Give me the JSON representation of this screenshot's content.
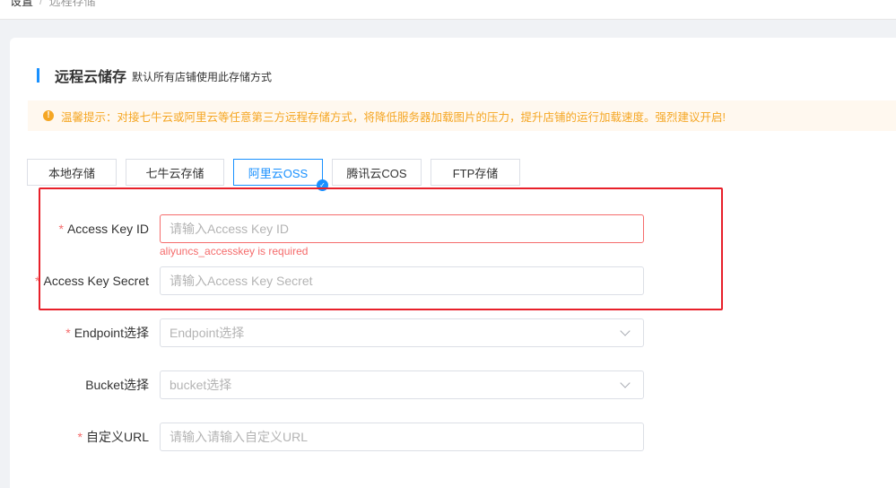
{
  "breadcrumb": {
    "parent": "设置",
    "separator": "/",
    "current": "远程存储"
  },
  "section": {
    "title": "远程云储存",
    "description": "默认所有店铺使用此存储方式"
  },
  "notice": {
    "icon": "info-circle-icon",
    "text": "温馨提示：对接七牛云或阿里云等任意第三方远程存储方式，将降低服务器加载图片的压力，提升店铺的运行加载速度。强烈建议开启!",
    "color": "#f5a623"
  },
  "tabs": [
    {
      "label": "本地存储",
      "active": false
    },
    {
      "label": "七牛云存储",
      "active": false
    },
    {
      "label": "阿里云OSS",
      "active": true
    },
    {
      "label": "腾讯云COS",
      "active": false
    },
    {
      "label": "FTP存储",
      "active": false
    }
  ],
  "form": {
    "access_key_id": {
      "label": "Access Key ID",
      "placeholder": "请输入Access Key ID",
      "value": "",
      "error": "aliyuncs_accesskey is required",
      "required": true
    },
    "access_key_secret": {
      "label": "Access Key Secret",
      "placeholder": "请输入Access Key Secret",
      "value": "",
      "required": true
    },
    "endpoint": {
      "label": "Endpoint选择",
      "placeholder": "Endpoint选择",
      "required": true
    },
    "bucket": {
      "label": "Bucket选择",
      "placeholder": "bucket选择",
      "required": false
    },
    "custom_url": {
      "label": "自定义URL",
      "placeholder": "请输入请输入自定义URL",
      "value": "",
      "required": true
    },
    "required_mark": "*"
  },
  "colors": {
    "accent": "#1890ff",
    "error": "#f56c6c",
    "highlight": "#e8202a"
  }
}
